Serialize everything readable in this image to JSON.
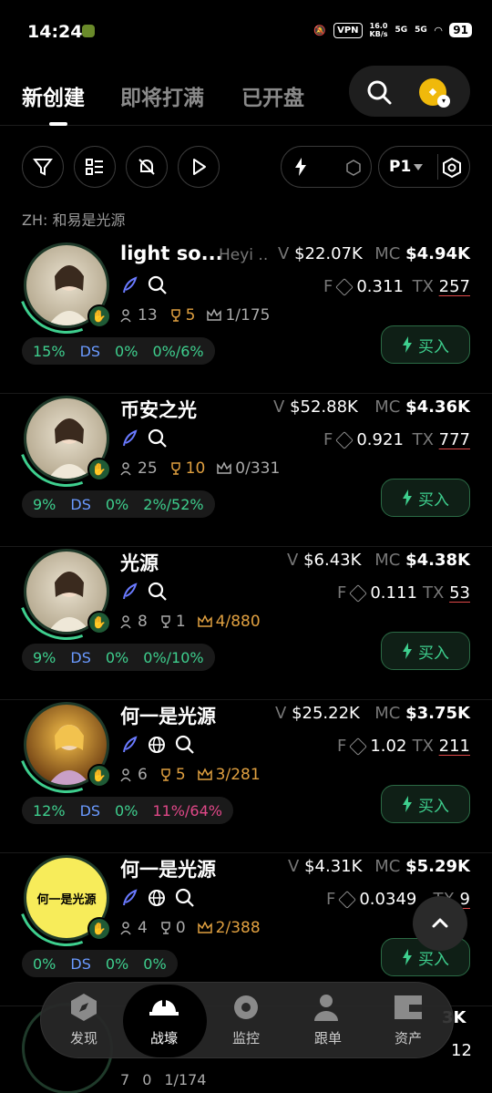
{
  "status": {
    "time": "14:24",
    "vpn": "VPN",
    "speed_top": "16.0",
    "speed_bottom": "KB/s",
    "net1": "5G",
    "net2": "5G",
    "battery": "91"
  },
  "tabs": [
    {
      "label": "新创建"
    },
    {
      "label": "即将打满"
    },
    {
      "label": "已开盘"
    }
  ],
  "toolbar": {
    "page": "P1"
  },
  "filter_label": "ZH: 和易是光源",
  "cards": [
    {
      "name": "light so...",
      "sub": "Heyi ..",
      "v_key": "V",
      "v": "$22.07K",
      "mc_key": "MC",
      "mc": "$4.94K",
      "f_key": "F",
      "f": "0.311",
      "tx_key": "TX",
      "tx": "257",
      "holders": "13",
      "trophies": "5",
      "crown": "1/175",
      "t1": "15%",
      "t2": "DS",
      "t3": "0%",
      "t4": "0%/6%",
      "buy": "买入"
    },
    {
      "name": "币安之光",
      "v_key": "V",
      "v": "$52.88K",
      "mc_key": "MC",
      "mc": "$4.36K",
      "f_key": "F",
      "f": "0.921",
      "tx_key": "TX",
      "tx": "777",
      "holders": "25",
      "trophies": "10",
      "crown": "0/331",
      "t1": "9%",
      "t2": "DS",
      "t3": "0%",
      "t4": "2%/52%",
      "buy": "买入"
    },
    {
      "name": "光源",
      "v_key": "V",
      "v": "$6.43K",
      "mc_key": "MC",
      "mc": "$4.38K",
      "f_key": "F",
      "f": "0.111",
      "tx_key": "TX",
      "tx": "53",
      "holders": "8",
      "trophies": "1",
      "crown": "4/880",
      "t1": "9%",
      "t2": "DS",
      "t3": "0%",
      "t4": "0%/10%",
      "buy": "买入"
    },
    {
      "name": "何一是光源",
      "v_key": "V",
      "v": "$25.22K",
      "mc_key": "MC",
      "mc": "$3.75K",
      "f_key": "F",
      "f": "1.02",
      "tx_key": "TX",
      "tx": "211",
      "holders": "6",
      "trophies": "5",
      "crown": "3/281",
      "t1": "12%",
      "t2": "DS",
      "t3": "0%",
      "t4": "11%/64%",
      "buy": "买入"
    },
    {
      "name": "何一是光源",
      "avatar_text": "何一是光源",
      "v_key": "V",
      "v": "$4.31K",
      "mc_key": "MC",
      "mc": "$5.29K",
      "f_key": "F",
      "f": "0.0349",
      "tx_key": "TX",
      "tx": "9",
      "holders": "4",
      "trophies": "0",
      "crown": "2/388",
      "t1": "0%",
      "t2": "DS",
      "t3": "0%",
      "t4": "0%",
      "buy": "买入"
    }
  ],
  "partial_row": {
    "a": "7",
    "b": "0",
    "c": "1/174",
    "tx": "12",
    "mc_tail": "3K"
  },
  "nav": [
    {
      "label": "发现"
    },
    {
      "label": "战壕"
    },
    {
      "label": "监控"
    },
    {
      "label": "跟单"
    },
    {
      "label": "资产"
    }
  ],
  "colors": {
    "accent": "#3ecf8e",
    "mc_red": "#e04848",
    "buy_bg": "#0f1f16",
    "gold": "#e0a040"
  }
}
